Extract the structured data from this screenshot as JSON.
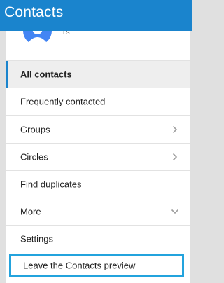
{
  "header": {
    "title": "Contacts"
  },
  "profile": {
    "name_fragment": "1s"
  },
  "menu": {
    "all_contacts": "All contacts",
    "frequently_contacted": "Frequently contacted",
    "groups": "Groups",
    "circles": "Circles",
    "find_duplicates": "Find duplicates",
    "more": "More",
    "settings": "Settings",
    "leave_preview": "Leave the Contacts preview"
  },
  "colors": {
    "header": "#1a84cd",
    "active_indicator": "#1a84cd",
    "highlight_box": "#23a3dd",
    "avatar": "#4285f4"
  },
  "icons": {
    "groups_chevron": "chevron-right-icon",
    "circles_chevron": "chevron-right-icon",
    "more_chevron": "chevron-down-icon"
  }
}
